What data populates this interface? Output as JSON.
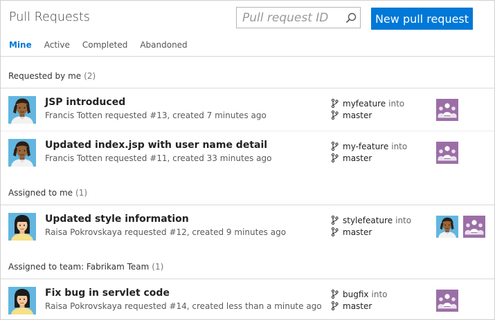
{
  "header": {
    "title": "Pull Requests",
    "search_placeholder": "Pull request ID",
    "new_button": "New pull request"
  },
  "tabs": [
    {
      "label": "Mine",
      "active": true
    },
    {
      "label": "Active",
      "active": false
    },
    {
      "label": "Completed",
      "active": false
    },
    {
      "label": "Abandoned",
      "active": false
    }
  ],
  "sections": [
    {
      "label": "Requested by me",
      "count": "(2)",
      "rows": [
        {
          "title": "JSP introduced",
          "subtitle": "Francis Totten requested #13, created 7 minutes ago",
          "source": "myfeature",
          "into": "into",
          "target": "master",
          "author_avatar": "francis",
          "reviewers": [
            "team"
          ]
        },
        {
          "title": "Updated index.jsp with user name detail",
          "subtitle": "Francis Totten requested #11, created 33 minutes ago",
          "source": "my-feature",
          "into": "into",
          "target": "master",
          "author_avatar": "francis",
          "reviewers": [
            "team"
          ]
        }
      ]
    },
    {
      "label": "Assigned to me",
      "count": "(1)",
      "rows": [
        {
          "title": "Updated style information",
          "subtitle": "Raisa Pokrovskaya requested #12, created 9 minutes ago",
          "source": "stylefeature",
          "into": "into",
          "target": "master",
          "author_avatar": "raisa",
          "reviewers": [
            "francis",
            "team"
          ]
        }
      ]
    },
    {
      "label": "Assigned to team: Fabrikam Team",
      "count": "(1)",
      "rows": [
        {
          "title": "Fix bug in servlet code",
          "subtitle": "Raisa Pokrovskaya requested #14, created less than a minute ago",
          "source": "bugfix",
          "into": "into",
          "target": "master",
          "author_avatar": "raisa",
          "reviewers": [
            "team"
          ]
        }
      ]
    }
  ],
  "colors": {
    "accent": "#0078d7",
    "team_avatar": "#9b6fa6"
  }
}
